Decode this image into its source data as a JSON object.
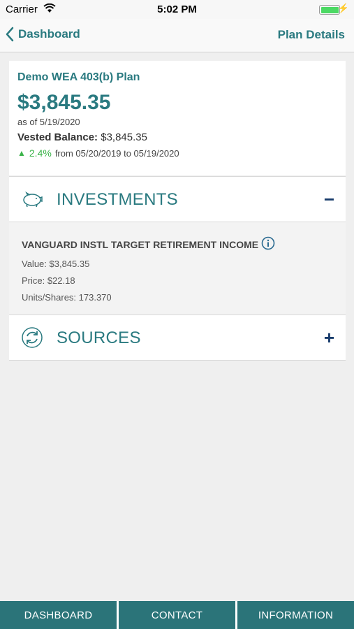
{
  "status": {
    "carrier": "Carrier",
    "time": "5:02 PM"
  },
  "nav": {
    "back_label": "Dashboard",
    "right_label": "Plan Details"
  },
  "summary": {
    "plan_name": "Demo WEA 403(b) Plan",
    "balance": "$3,845.35",
    "as_of": "as of 5/19/2020",
    "vested_label": "Vested Balance:",
    "vested_value": "$3,845.35",
    "change_pct": "2.4%",
    "change_range": "from 05/20/2019 to 05/19/2020"
  },
  "investments": {
    "title": "INVESTMENTS",
    "toggle": "−",
    "fund": {
      "name": "VANGUARD INSTL TARGET RETIREMENT INCOME",
      "value": "Value: $3,845.35",
      "price": "Price: $22.18",
      "units": "Units/Shares: 173.370"
    }
  },
  "sources": {
    "title": "SOURCES",
    "toggle": "+"
  },
  "tabs": [
    "DASHBOARD",
    "CONTACT",
    "INFORMATION"
  ],
  "colors": {
    "accent": "#2a7a80",
    "tab_bg": "#2b7479",
    "toggle": "#173b6b",
    "positive": "#3bb34a"
  }
}
